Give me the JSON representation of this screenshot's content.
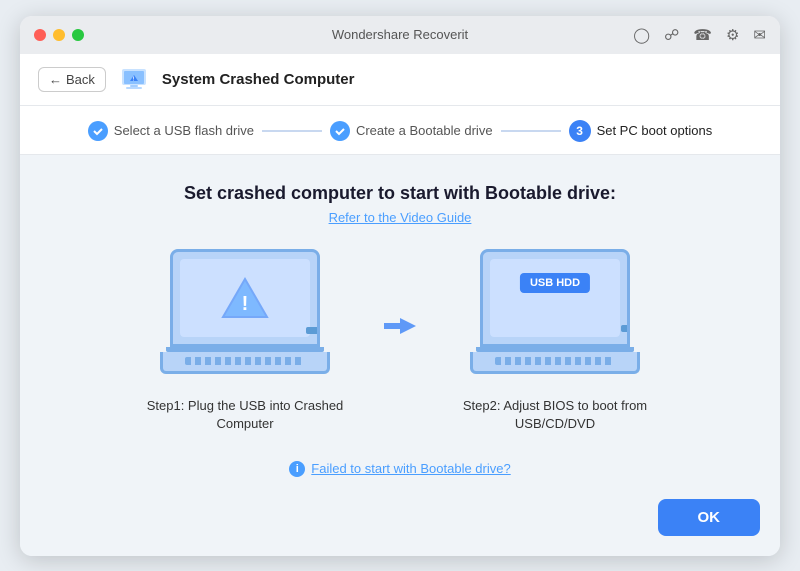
{
  "titlebar": {
    "title": "Wondershare Recoverit",
    "icons": [
      "person-icon",
      "signin-icon",
      "headset-icon",
      "settings-icon",
      "mail-icon"
    ]
  },
  "header": {
    "back_label": "Back",
    "title": "System Crashed Computer"
  },
  "steps": [
    {
      "id": 1,
      "label": "Select a USB flash drive",
      "state": "done"
    },
    {
      "id": 2,
      "label": "Create a Bootable drive",
      "state": "done"
    },
    {
      "id": 3,
      "label": "Set PC boot options",
      "state": "active"
    }
  ],
  "main": {
    "title": "Set crashed computer to start with Bootable drive:",
    "video_link": "Refer to the Video Guide",
    "step1": {
      "desc_line1": "Step1:  Plug the USB into Crashed",
      "desc_line2": "Computer",
      "usb_hdd": ""
    },
    "step2": {
      "desc": "Step2: Adjust BIOS to boot from USB/CD/DVD",
      "usb_hdd_label": "USB HDD"
    },
    "failed_link": "Failed to start with Bootable drive?",
    "ok_label": "OK"
  }
}
